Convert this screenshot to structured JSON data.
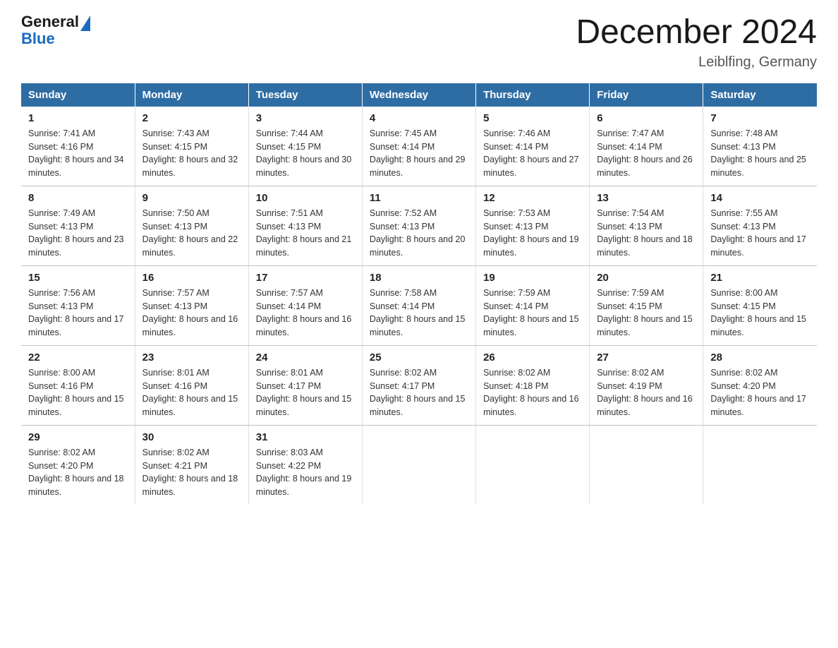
{
  "logo": {
    "general": "General",
    "triangle": "▶",
    "blue": "Blue"
  },
  "header": {
    "title": "December 2024",
    "location": "Leiblfing, Germany"
  },
  "days_of_week": [
    "Sunday",
    "Monday",
    "Tuesday",
    "Wednesday",
    "Thursday",
    "Friday",
    "Saturday"
  ],
  "weeks": [
    [
      {
        "day": "1",
        "sunrise": "7:41 AM",
        "sunset": "4:16 PM",
        "daylight": "8 hours and 34 minutes."
      },
      {
        "day": "2",
        "sunrise": "7:43 AM",
        "sunset": "4:15 PM",
        "daylight": "8 hours and 32 minutes."
      },
      {
        "day": "3",
        "sunrise": "7:44 AM",
        "sunset": "4:15 PM",
        "daylight": "8 hours and 30 minutes."
      },
      {
        "day": "4",
        "sunrise": "7:45 AM",
        "sunset": "4:14 PM",
        "daylight": "8 hours and 29 minutes."
      },
      {
        "day": "5",
        "sunrise": "7:46 AM",
        "sunset": "4:14 PM",
        "daylight": "8 hours and 27 minutes."
      },
      {
        "day": "6",
        "sunrise": "7:47 AM",
        "sunset": "4:14 PM",
        "daylight": "8 hours and 26 minutes."
      },
      {
        "day": "7",
        "sunrise": "7:48 AM",
        "sunset": "4:13 PM",
        "daylight": "8 hours and 25 minutes."
      }
    ],
    [
      {
        "day": "8",
        "sunrise": "7:49 AM",
        "sunset": "4:13 PM",
        "daylight": "8 hours and 23 minutes."
      },
      {
        "day": "9",
        "sunrise": "7:50 AM",
        "sunset": "4:13 PM",
        "daylight": "8 hours and 22 minutes."
      },
      {
        "day": "10",
        "sunrise": "7:51 AM",
        "sunset": "4:13 PM",
        "daylight": "8 hours and 21 minutes."
      },
      {
        "day": "11",
        "sunrise": "7:52 AM",
        "sunset": "4:13 PM",
        "daylight": "8 hours and 20 minutes."
      },
      {
        "day": "12",
        "sunrise": "7:53 AM",
        "sunset": "4:13 PM",
        "daylight": "8 hours and 19 minutes."
      },
      {
        "day": "13",
        "sunrise": "7:54 AM",
        "sunset": "4:13 PM",
        "daylight": "8 hours and 18 minutes."
      },
      {
        "day": "14",
        "sunrise": "7:55 AM",
        "sunset": "4:13 PM",
        "daylight": "8 hours and 17 minutes."
      }
    ],
    [
      {
        "day": "15",
        "sunrise": "7:56 AM",
        "sunset": "4:13 PM",
        "daylight": "8 hours and 17 minutes."
      },
      {
        "day": "16",
        "sunrise": "7:57 AM",
        "sunset": "4:13 PM",
        "daylight": "8 hours and 16 minutes."
      },
      {
        "day": "17",
        "sunrise": "7:57 AM",
        "sunset": "4:14 PM",
        "daylight": "8 hours and 16 minutes."
      },
      {
        "day": "18",
        "sunrise": "7:58 AM",
        "sunset": "4:14 PM",
        "daylight": "8 hours and 15 minutes."
      },
      {
        "day": "19",
        "sunrise": "7:59 AM",
        "sunset": "4:14 PM",
        "daylight": "8 hours and 15 minutes."
      },
      {
        "day": "20",
        "sunrise": "7:59 AM",
        "sunset": "4:15 PM",
        "daylight": "8 hours and 15 minutes."
      },
      {
        "day": "21",
        "sunrise": "8:00 AM",
        "sunset": "4:15 PM",
        "daylight": "8 hours and 15 minutes."
      }
    ],
    [
      {
        "day": "22",
        "sunrise": "8:00 AM",
        "sunset": "4:16 PM",
        "daylight": "8 hours and 15 minutes."
      },
      {
        "day": "23",
        "sunrise": "8:01 AM",
        "sunset": "4:16 PM",
        "daylight": "8 hours and 15 minutes."
      },
      {
        "day": "24",
        "sunrise": "8:01 AM",
        "sunset": "4:17 PM",
        "daylight": "8 hours and 15 minutes."
      },
      {
        "day": "25",
        "sunrise": "8:02 AM",
        "sunset": "4:17 PM",
        "daylight": "8 hours and 15 minutes."
      },
      {
        "day": "26",
        "sunrise": "8:02 AM",
        "sunset": "4:18 PM",
        "daylight": "8 hours and 16 minutes."
      },
      {
        "day": "27",
        "sunrise": "8:02 AM",
        "sunset": "4:19 PM",
        "daylight": "8 hours and 16 minutes."
      },
      {
        "day": "28",
        "sunrise": "8:02 AM",
        "sunset": "4:20 PM",
        "daylight": "8 hours and 17 minutes."
      }
    ],
    [
      {
        "day": "29",
        "sunrise": "8:02 AM",
        "sunset": "4:20 PM",
        "daylight": "8 hours and 18 minutes."
      },
      {
        "day": "30",
        "sunrise": "8:02 AM",
        "sunset": "4:21 PM",
        "daylight": "8 hours and 18 minutes."
      },
      {
        "day": "31",
        "sunrise": "8:03 AM",
        "sunset": "4:22 PM",
        "daylight": "8 hours and 19 minutes."
      },
      null,
      null,
      null,
      null
    ]
  ]
}
